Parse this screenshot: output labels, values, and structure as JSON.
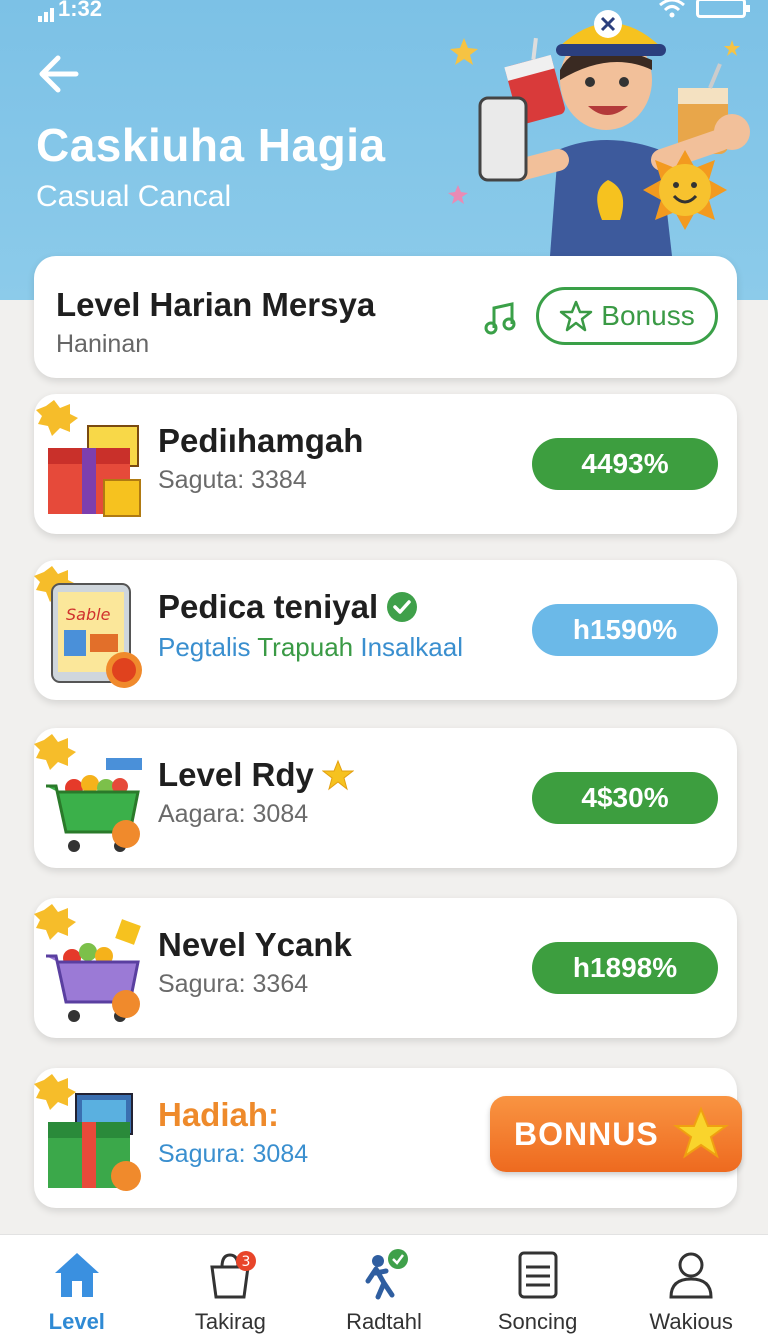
{
  "status_bar": {
    "time": "1:32"
  },
  "header": {
    "title": "Caskiuha Hagia",
    "subtitle": "Casual Cancal"
  },
  "top_card": {
    "title": "Level Harian Mersya",
    "subtitle": "Haninan",
    "bonus_label": "Bonuss"
  },
  "items": [
    {
      "name": "Pediıhamgah",
      "meta": "Saguta: 3384",
      "percent": "4493%",
      "pill_color": "green"
    },
    {
      "name": "Pedica teniyal",
      "meta_blue": "Pegtalis",
      "meta_green": "Trapuah",
      "meta_blue2": "Insalkaal",
      "percent": "h1590%",
      "pill_color": "blue"
    },
    {
      "name": "Level Rdy",
      "meta": "Aagara: 3084",
      "percent": "4$30%",
      "pill_color": "green"
    },
    {
      "name": "Nevel Ycank",
      "meta": "Sagura: 3364",
      "percent": "h1898%",
      "pill_color": "green"
    },
    {
      "name": "Hadiah:",
      "meta": "Sagura: 3084",
      "button": "BONNUS"
    }
  ],
  "nav": [
    {
      "label": "Level",
      "icon": "home-icon",
      "active": true
    },
    {
      "label": "Takirag",
      "icon": "bag-icon",
      "badge": "3"
    },
    {
      "label": "Radtahl",
      "icon": "runner-icon"
    },
    {
      "label": "Soncing",
      "icon": "list-icon"
    },
    {
      "label": "Wakious",
      "icon": "user-icon"
    }
  ],
  "colors": {
    "header_bg": "#7cc1e6",
    "green": "#3d9e3f",
    "blue": "#6bb9e8",
    "orange": "#ee8a2b",
    "nav_active": "#2f8ad4"
  }
}
